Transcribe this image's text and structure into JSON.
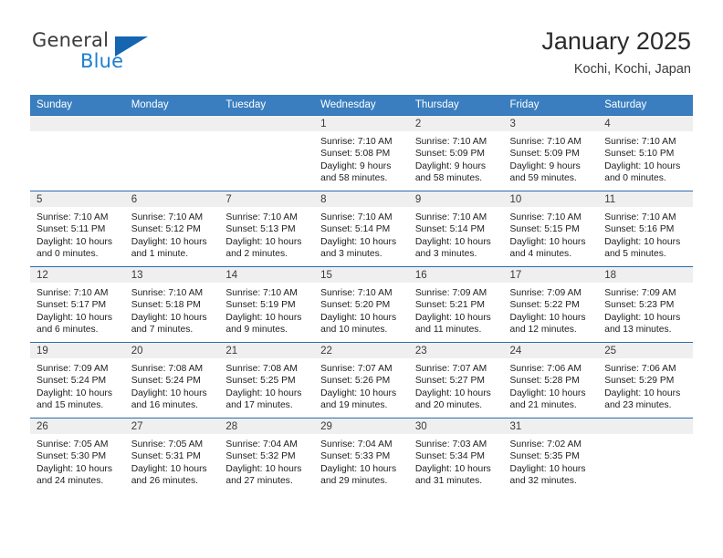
{
  "brand": {
    "name_top": "General",
    "name_bottom": "Blue",
    "accent_color": "#1565b0",
    "text_color": "#3b3b3b"
  },
  "header": {
    "title": "January 2025",
    "subtitle": "Kochi, Kochi, Japan"
  },
  "calendar": {
    "header_bg": "#3a7ebf",
    "header_text_color": "#ffffff",
    "daynum_bg": "#efefef",
    "row_border_color": "#2b6cac",
    "weekday_headers": [
      "Sunday",
      "Monday",
      "Tuesday",
      "Wednesday",
      "Thursday",
      "Friday",
      "Saturday"
    ],
    "weeks": [
      [
        {
          "day": "",
          "lines": []
        },
        {
          "day": "",
          "lines": []
        },
        {
          "day": "",
          "lines": []
        },
        {
          "day": "1",
          "lines": [
            "Sunrise: 7:10 AM",
            "Sunset: 5:08 PM",
            "Daylight: 9 hours",
            "and 58 minutes."
          ]
        },
        {
          "day": "2",
          "lines": [
            "Sunrise: 7:10 AM",
            "Sunset: 5:09 PM",
            "Daylight: 9 hours",
            "and 58 minutes."
          ]
        },
        {
          "day": "3",
          "lines": [
            "Sunrise: 7:10 AM",
            "Sunset: 5:09 PM",
            "Daylight: 9 hours",
            "and 59 minutes."
          ]
        },
        {
          "day": "4",
          "lines": [
            "Sunrise: 7:10 AM",
            "Sunset: 5:10 PM",
            "Daylight: 10 hours",
            "and 0 minutes."
          ]
        }
      ],
      [
        {
          "day": "5",
          "lines": [
            "Sunrise: 7:10 AM",
            "Sunset: 5:11 PM",
            "Daylight: 10 hours",
            "and 0 minutes."
          ]
        },
        {
          "day": "6",
          "lines": [
            "Sunrise: 7:10 AM",
            "Sunset: 5:12 PM",
            "Daylight: 10 hours",
            "and 1 minute."
          ]
        },
        {
          "day": "7",
          "lines": [
            "Sunrise: 7:10 AM",
            "Sunset: 5:13 PM",
            "Daylight: 10 hours",
            "and 2 minutes."
          ]
        },
        {
          "day": "8",
          "lines": [
            "Sunrise: 7:10 AM",
            "Sunset: 5:14 PM",
            "Daylight: 10 hours",
            "and 3 minutes."
          ]
        },
        {
          "day": "9",
          "lines": [
            "Sunrise: 7:10 AM",
            "Sunset: 5:14 PM",
            "Daylight: 10 hours",
            "and 3 minutes."
          ]
        },
        {
          "day": "10",
          "lines": [
            "Sunrise: 7:10 AM",
            "Sunset: 5:15 PM",
            "Daylight: 10 hours",
            "and 4 minutes."
          ]
        },
        {
          "day": "11",
          "lines": [
            "Sunrise: 7:10 AM",
            "Sunset: 5:16 PM",
            "Daylight: 10 hours",
            "and 5 minutes."
          ]
        }
      ],
      [
        {
          "day": "12",
          "lines": [
            "Sunrise: 7:10 AM",
            "Sunset: 5:17 PM",
            "Daylight: 10 hours",
            "and 6 minutes."
          ]
        },
        {
          "day": "13",
          "lines": [
            "Sunrise: 7:10 AM",
            "Sunset: 5:18 PM",
            "Daylight: 10 hours",
            "and 7 minutes."
          ]
        },
        {
          "day": "14",
          "lines": [
            "Sunrise: 7:10 AM",
            "Sunset: 5:19 PM",
            "Daylight: 10 hours",
            "and 9 minutes."
          ]
        },
        {
          "day": "15",
          "lines": [
            "Sunrise: 7:10 AM",
            "Sunset: 5:20 PM",
            "Daylight: 10 hours",
            "and 10 minutes."
          ]
        },
        {
          "day": "16",
          "lines": [
            "Sunrise: 7:09 AM",
            "Sunset: 5:21 PM",
            "Daylight: 10 hours",
            "and 11 minutes."
          ]
        },
        {
          "day": "17",
          "lines": [
            "Sunrise: 7:09 AM",
            "Sunset: 5:22 PM",
            "Daylight: 10 hours",
            "and 12 minutes."
          ]
        },
        {
          "day": "18",
          "lines": [
            "Sunrise: 7:09 AM",
            "Sunset: 5:23 PM",
            "Daylight: 10 hours",
            "and 13 minutes."
          ]
        }
      ],
      [
        {
          "day": "19",
          "lines": [
            "Sunrise: 7:09 AM",
            "Sunset: 5:24 PM",
            "Daylight: 10 hours",
            "and 15 minutes."
          ]
        },
        {
          "day": "20",
          "lines": [
            "Sunrise: 7:08 AM",
            "Sunset: 5:24 PM",
            "Daylight: 10 hours",
            "and 16 minutes."
          ]
        },
        {
          "day": "21",
          "lines": [
            "Sunrise: 7:08 AM",
            "Sunset: 5:25 PM",
            "Daylight: 10 hours",
            "and 17 minutes."
          ]
        },
        {
          "day": "22",
          "lines": [
            "Sunrise: 7:07 AM",
            "Sunset: 5:26 PM",
            "Daylight: 10 hours",
            "and 19 minutes."
          ]
        },
        {
          "day": "23",
          "lines": [
            "Sunrise: 7:07 AM",
            "Sunset: 5:27 PM",
            "Daylight: 10 hours",
            "and 20 minutes."
          ]
        },
        {
          "day": "24",
          "lines": [
            "Sunrise: 7:06 AM",
            "Sunset: 5:28 PM",
            "Daylight: 10 hours",
            "and 21 minutes."
          ]
        },
        {
          "day": "25",
          "lines": [
            "Sunrise: 7:06 AM",
            "Sunset: 5:29 PM",
            "Daylight: 10 hours",
            "and 23 minutes."
          ]
        }
      ],
      [
        {
          "day": "26",
          "lines": [
            "Sunrise: 7:05 AM",
            "Sunset: 5:30 PM",
            "Daylight: 10 hours",
            "and 24 minutes."
          ]
        },
        {
          "day": "27",
          "lines": [
            "Sunrise: 7:05 AM",
            "Sunset: 5:31 PM",
            "Daylight: 10 hours",
            "and 26 minutes."
          ]
        },
        {
          "day": "28",
          "lines": [
            "Sunrise: 7:04 AM",
            "Sunset: 5:32 PM",
            "Daylight: 10 hours",
            "and 27 minutes."
          ]
        },
        {
          "day": "29",
          "lines": [
            "Sunrise: 7:04 AM",
            "Sunset: 5:33 PM",
            "Daylight: 10 hours",
            "and 29 minutes."
          ]
        },
        {
          "day": "30",
          "lines": [
            "Sunrise: 7:03 AM",
            "Sunset: 5:34 PM",
            "Daylight: 10 hours",
            "and 31 minutes."
          ]
        },
        {
          "day": "31",
          "lines": [
            "Sunrise: 7:02 AM",
            "Sunset: 5:35 PM",
            "Daylight: 10 hours",
            "and 32 minutes."
          ]
        },
        {
          "day": "",
          "lines": []
        }
      ]
    ]
  }
}
